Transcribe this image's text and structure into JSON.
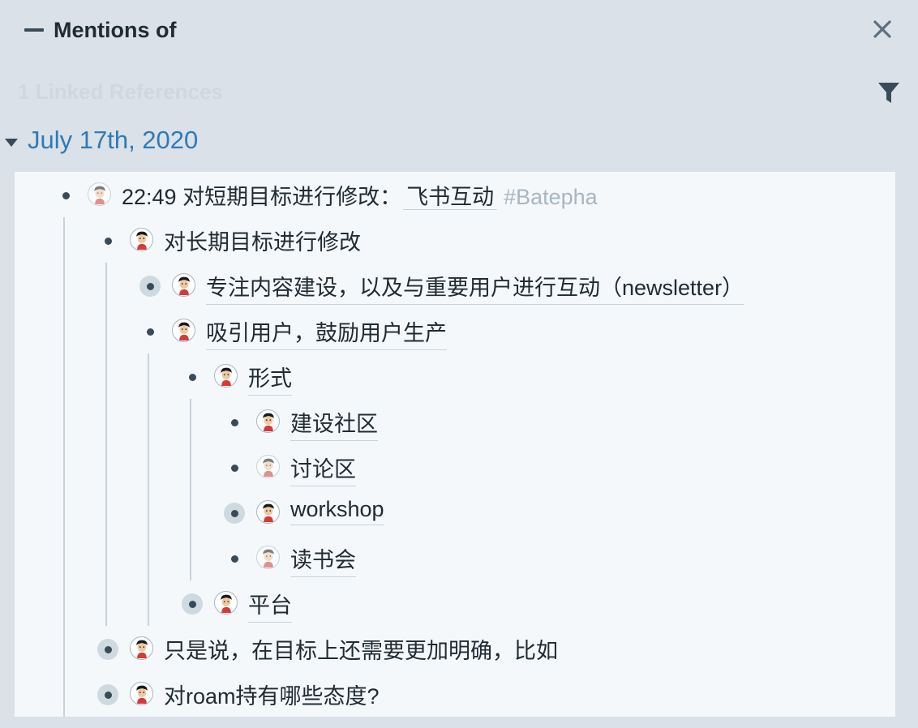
{
  "header": {
    "title": "Mentions of",
    "linked_references": "1 Linked References"
  },
  "date": "July 17th, 2020",
  "blocks": {
    "b1": {
      "time": "22:49",
      "text": "对短期目标进行修改：",
      "page_ref": "飞书互动",
      "tag": "#Batepha"
    },
    "b2": "对长期目标进行修改",
    "b3": "专注内容建设，以及与重要用户进行互动（newsletter）",
    "b4": "吸引用户，鼓励用户生产",
    "b5": "形式",
    "b6": "建设社区",
    "b7": "讨论区",
    "b8": "workshop",
    "b9": "读书会",
    "b10": "平台",
    "b11": "只是说，在目标上还需要更加明确，比如",
    "b12": "对roam持有哪些态度?"
  },
  "colors": {
    "background": "#dae1e8",
    "panel": "#f5f8fa",
    "date_link": "#2f7ab6",
    "text": "#202b33",
    "guide": "#c8d2db"
  },
  "icons": [
    "collapse-icon",
    "close-icon",
    "filter-icon",
    "caret-down-icon",
    "bullet-icon",
    "avatar-icon"
  ]
}
